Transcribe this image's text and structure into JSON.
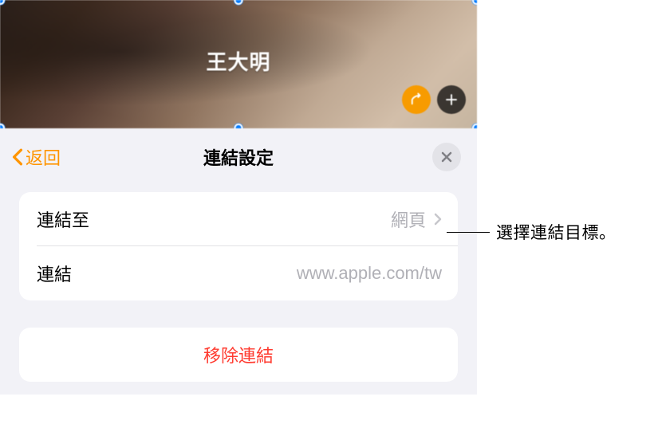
{
  "header": {
    "title": "王大明"
  },
  "popover": {
    "back_label": "返回",
    "title": "連結設定",
    "link_to": {
      "label": "連結至",
      "value": "網頁"
    },
    "link_url": {
      "label": "連結",
      "placeholder": "www.apple.com/tw"
    },
    "remove_label": "移除連結"
  },
  "callout": {
    "text": "選擇連結目標。"
  }
}
